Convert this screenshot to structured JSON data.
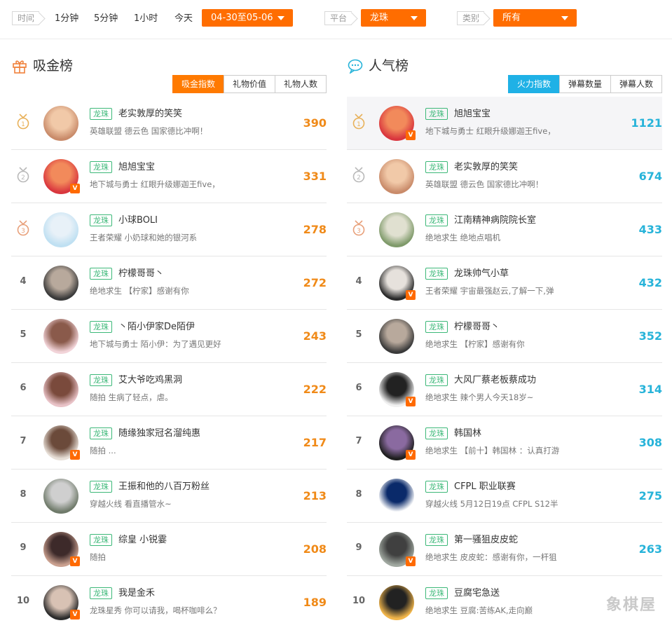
{
  "filters": {
    "time_label": "时间",
    "time_options": [
      "1分钟",
      "5分钟",
      "1小时",
      "今天"
    ],
    "date_range": "04-30至05-06",
    "platform_label": "平台",
    "platform_value": "龙珠",
    "category_label": "类别",
    "category_value": "所有"
  },
  "gold": {
    "title": "吸金榜",
    "icon": "gift-icon",
    "tabs": [
      "吸金指数",
      "礼物价值",
      "礼物人数"
    ],
    "rows": [
      {
        "rank": "1",
        "platform": "龙珠",
        "name": "老实敦厚的笑笑",
        "desc": "英雄联盟 德云色 国家德比冲啊！",
        "score": "390"
      },
      {
        "rank": "2",
        "platform": "龙珠",
        "name": "旭旭宝宝",
        "desc": "地下城与勇士 红眼升级娜迦王five，",
        "score": "331"
      },
      {
        "rank": "3",
        "platform": "龙珠",
        "name": "小球BOLI",
        "desc": "王者荣耀 小奶球和她的银河系",
        "score": "278"
      },
      {
        "rank": "4",
        "platform": "龙珠",
        "name": "柠檬哥哥丶",
        "desc": "绝地求生 【柠家】感谢有你",
        "score": "272"
      },
      {
        "rank": "5",
        "platform": "龙珠",
        "name": "丶陌小伊家De陌伊",
        "desc": "地下城与勇士 陌小伊：为了遇见更好",
        "score": "243"
      },
      {
        "rank": "6",
        "platform": "龙珠",
        "name": "艾大爷吃鸡黑洞",
        "desc": "随拍 生病了轻点，虐。",
        "score": "222"
      },
      {
        "rank": "7",
        "platform": "龙珠",
        "name": "随缘独家冠名溜纯惠",
        "desc": "随拍 ...",
        "score": "217"
      },
      {
        "rank": "8",
        "platform": "龙珠",
        "name": "王振和他的八百万粉丝",
        "desc": "穿越火线 看直播管水~",
        "score": "213"
      },
      {
        "rank": "9",
        "platform": "龙珠",
        "name": "综皇 小锐霎",
        "desc": "随拍",
        "score": "208"
      },
      {
        "rank": "10",
        "platform": "龙珠",
        "name": "我是金禾",
        "desc": "龙珠星秀 你可以请我，喝杯咖啡么？",
        "score": "189"
      }
    ]
  },
  "popular": {
    "title": "人气榜",
    "icon": "chat-bubble-icon",
    "tabs": [
      "火力指数",
      "弹幕数量",
      "弹幕人数"
    ],
    "rows": [
      {
        "rank": "1",
        "platform": "龙珠",
        "name": "旭旭宝宝",
        "desc": "地下城与勇士 红眼升级娜迦王five，",
        "score": "1121"
      },
      {
        "rank": "2",
        "platform": "龙珠",
        "name": "老实敦厚的笑笑",
        "desc": "英雄联盟 德云色 国家德比冲啊！",
        "score": "674"
      },
      {
        "rank": "3",
        "platform": "龙珠",
        "name": "江南精神病院院长室",
        "desc": "绝地求生 绝地点唱机",
        "score": "433"
      },
      {
        "rank": "4",
        "platform": "龙珠",
        "name": "龙珠帅气小草",
        "desc": "王者荣耀 宇宙最强赵云,了解一下,弹",
        "score": "432"
      },
      {
        "rank": "5",
        "platform": "龙珠",
        "name": "柠檬哥哥丶",
        "desc": "绝地求生 【柠家】感谢有你",
        "score": "352"
      },
      {
        "rank": "6",
        "platform": "龙珠",
        "name": "大风厂蔡老板蔡成功",
        "desc": "绝地求生 辣个男人今天18岁~",
        "score": "314"
      },
      {
        "rank": "7",
        "platform": "龙珠",
        "name": "韩国林",
        "desc": "绝地求生 【前十】韩国林 ：认真打游",
        "score": "308"
      },
      {
        "rank": "8",
        "platform": "龙珠",
        "name": "CFPL 职业联赛",
        "desc": "穿越火线 5月12日19点 CFPL S12半",
        "score": "275"
      },
      {
        "rank": "9",
        "platform": "龙珠",
        "name": "第一骚狙皮皮蛇",
        "desc": "绝地求生 皮皮蛇：感谢有你，一杆狙",
        "score": "263"
      },
      {
        "rank": "10",
        "platform": "龙珠",
        "name": "豆腐宅急送",
        "desc": "绝地求生 豆腐:苦练AK,走向巅",
        "score": ""
      }
    ]
  },
  "watermark": "象棋屋",
  "colors": {
    "orange": "#ff6d00",
    "blue": "#1fb1e6",
    "green": "#3cb878",
    "gold_score": "#f08a18",
    "pop_score": "#27b3d9"
  }
}
